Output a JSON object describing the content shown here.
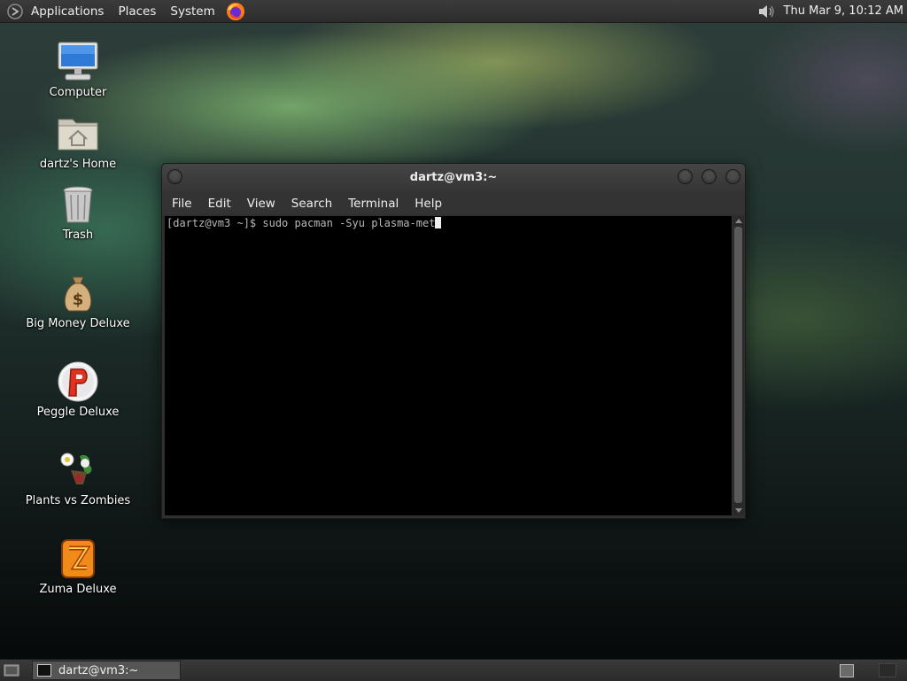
{
  "top_panel": {
    "menus": [
      "Applications",
      "Places",
      "System"
    ],
    "clock": "Thu Mar  9, 10:12 AM",
    "icons": [
      "gnome-foot-icon",
      "firefox-icon",
      "volume-icon"
    ]
  },
  "desktop_icons": [
    {
      "label": "Computer",
      "icon": "computer-icon"
    },
    {
      "label": "dartz's Home",
      "icon": "home-folder-icon"
    },
    {
      "label": "Trash",
      "icon": "trash-icon"
    },
    {
      "label": "Big Money Deluxe",
      "icon": "money-bag-icon"
    },
    {
      "label": "Peggle Deluxe",
      "icon": "peggle-icon"
    },
    {
      "label": "Plants vs Zombies",
      "icon": "plants-icon"
    },
    {
      "label": "Zuma Deluxe",
      "icon": "zuma-icon"
    }
  ],
  "terminal": {
    "title": "dartz@vm3:~",
    "menu": [
      "File",
      "Edit",
      "View",
      "Search",
      "Terminal",
      "Help"
    ],
    "line": "[dartz@vm3 ~]$ sudo pacman -Syu plasma-met"
  },
  "taskbar": {
    "task_label": "dartz@vm3:~"
  }
}
